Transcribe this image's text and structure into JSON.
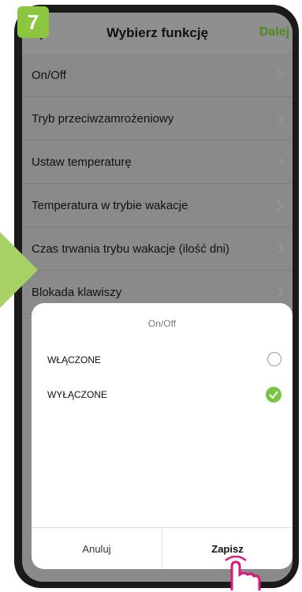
{
  "step": "7",
  "header": {
    "title": "Wybierz funkcję",
    "next_label": "Dalej"
  },
  "list": [
    {
      "label": "On/Off"
    },
    {
      "label": "Tryb przeciwzamrożeniowy"
    },
    {
      "label": "Ustaw temperaturę"
    },
    {
      "label": "Temperatura w trybie wakacje"
    },
    {
      "label": "Czas trwania trybu wakacje (ilość dni)"
    },
    {
      "label": "Blokada klawiszy"
    }
  ],
  "sheet": {
    "title": "On/Off",
    "options": [
      {
        "label": "WŁĄCZONE",
        "selected": false
      },
      {
        "label": "WYŁĄCZONE",
        "selected": true
      }
    ],
    "cancel_label": "Anuluj",
    "save_label": "Zapisz"
  },
  "colors": {
    "accent": "#8cc63f",
    "check": "#7cc243",
    "next": "#4e8a1c",
    "pointer": "#d6197c"
  }
}
